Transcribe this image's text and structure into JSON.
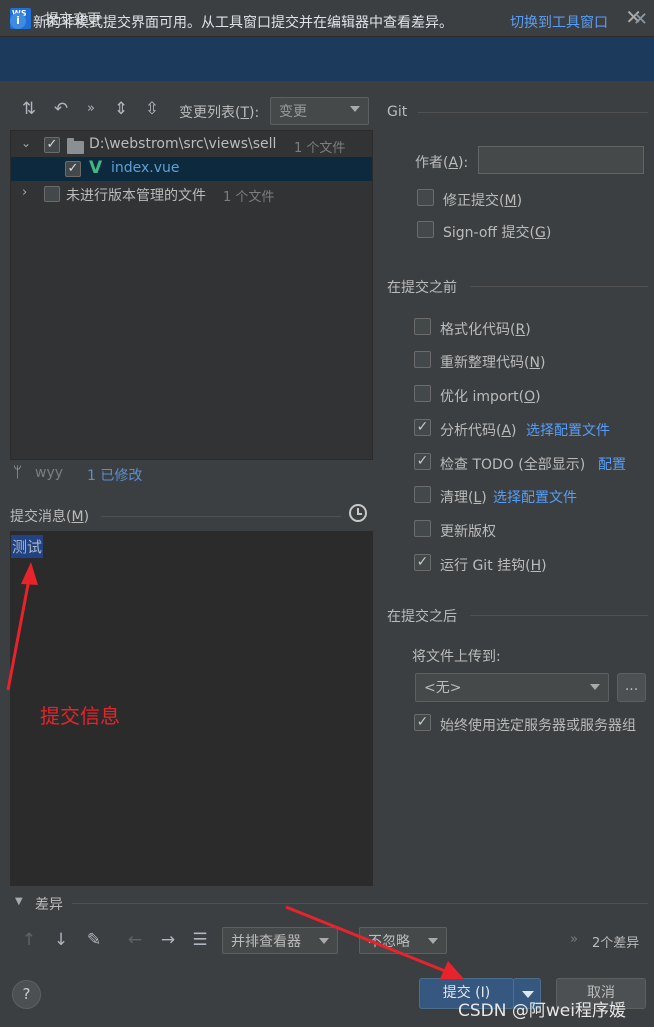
{
  "window": {
    "title": "提交变更",
    "app_icon": "WS"
  },
  "banner": {
    "text": "新的非模式提交界面可用。从工具窗口提交并在编辑器中查看差异。",
    "link": "切换到工具窗口"
  },
  "toolbar": {
    "changelist_label": "变更列表(",
    "changelist_key": "T",
    "changelist_suffix": "):",
    "changelist_value": "变更"
  },
  "tree": {
    "rows": [
      {
        "label": "D:\\webstrom\\src\\views\\sell",
        "count": "1 个文件"
      },
      {
        "label": "index.vue"
      },
      {
        "label": "未进行版本管理的文件",
        "count": "1 个文件"
      }
    ]
  },
  "branch": {
    "name": "wyy",
    "changes": "1 已修改"
  },
  "message": {
    "label": "提交消息(",
    "key": "M",
    "suffix": ")",
    "value": "测试"
  },
  "annotation": {
    "text": "提交信息"
  },
  "git": {
    "title": "Git",
    "author_label": "作者(",
    "author_key": "A",
    "author_suffix": "):",
    "author_value": "",
    "amend": {
      "label": "修正提交(",
      "key": "M",
      "suffix": ")",
      "checked": false
    },
    "signoff": {
      "label": "Sign-off 提交(",
      "key": "G",
      "suffix": ")",
      "checked": false
    }
  },
  "before_commit": {
    "title": "在提交之前",
    "items": [
      {
        "label": "格式化代码(",
        "key": "R",
        "suffix": ")",
        "link": "",
        "checked": false
      },
      {
        "label": "重新整理代码(",
        "key": "N",
        "suffix": ")",
        "link": "",
        "checked": false
      },
      {
        "label": "优化 import(",
        "key": "O",
        "suffix": ")",
        "link": "",
        "checked": false
      },
      {
        "label": "分析代码(",
        "key": "A",
        "suffix": ")",
        "link": "选择配置文件",
        "checked": true
      },
      {
        "label": "检查 TODO (全部显示)",
        "key": "",
        "suffix": "",
        "link": "配置",
        "checked": true
      },
      {
        "label": "清理(",
        "key": "L",
        "suffix": ")",
        "link": "选择配置文件",
        "checked": false
      },
      {
        "label": "更新版权",
        "key": "",
        "suffix": "",
        "link": "",
        "checked": false
      },
      {
        "label": "运行 Git 挂钩(",
        "key": "H",
        "suffix": ")",
        "link": "",
        "checked": true
      }
    ]
  },
  "after_commit": {
    "title": "在提交之后",
    "upload_label": "将文件上传到:",
    "upload_value": "<无>",
    "browse": "...",
    "always_label": "始终使用选定服务器或服务器组",
    "always_checked": true
  },
  "diff": {
    "title": "差异",
    "viewer": "并排查看器",
    "ignore": "不忽略",
    "count": "2个差异"
  },
  "footer": {
    "help": "?",
    "commit": "提交 (I)",
    "cancel": "取消"
  },
  "watermark": "CSDN @阿wei程序媛"
}
